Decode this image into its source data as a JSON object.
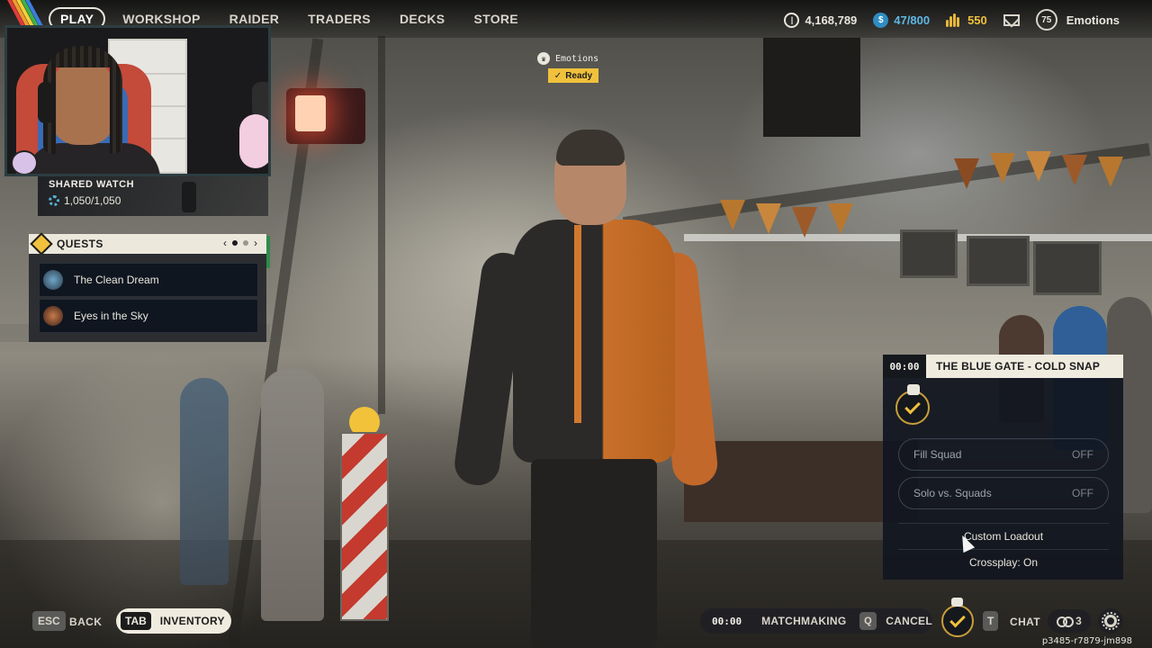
{
  "nav": {
    "items": [
      {
        "label": "PLAY",
        "active": true
      },
      {
        "label": "WORKSHOP",
        "active": false
      },
      {
        "label": "RAIDER",
        "active": false
      },
      {
        "label": "TRADERS",
        "active": false
      },
      {
        "label": "DECKS",
        "active": false
      },
      {
        "label": "STORE",
        "active": false
      }
    ],
    "coins": "4,168,789",
    "tokens": "47/800",
    "gold": "550",
    "level": "75",
    "profile_name": "Emotions"
  },
  "shared_watch": {
    "title": "SHARED WATCH",
    "value": "1,050/1,050"
  },
  "quests": {
    "title": "QUESTS",
    "items": [
      {
        "label": "The Clean Dream"
      },
      {
        "label": "Eyes in the Sky"
      }
    ]
  },
  "player_tag": {
    "name": "Emotions",
    "status": "Ready"
  },
  "matchmaking_panel": {
    "timer": "00:00",
    "map": "THE BLUE GATE - COLD SNAP",
    "fill_squad_label": "Fill Squad",
    "fill_squad_state": "OFF",
    "solo_label": "Solo vs. Squads",
    "solo_state": "OFF",
    "custom_loadout": "Custom Loadout",
    "crossplay": "Crossplay: On"
  },
  "bottom_bar": {
    "back_key": "ESC",
    "back_label": "BACK",
    "inventory_key": "TAB",
    "inventory_label": "INVENTORY",
    "mm_time": "00:00",
    "mm_label": "MATCHMAKING",
    "cancel_key": "Q",
    "cancel_label": "CANCEL",
    "chat_key": "T",
    "chat_label": "CHAT",
    "squad_count": "3"
  },
  "build_id": "p3485-r7879-jm898",
  "colors": {
    "accent_gold": "#f0c13c",
    "token_blue": "#5fb8e6",
    "panel_cream": "#efebdf",
    "panel_dark": "#121620"
  }
}
